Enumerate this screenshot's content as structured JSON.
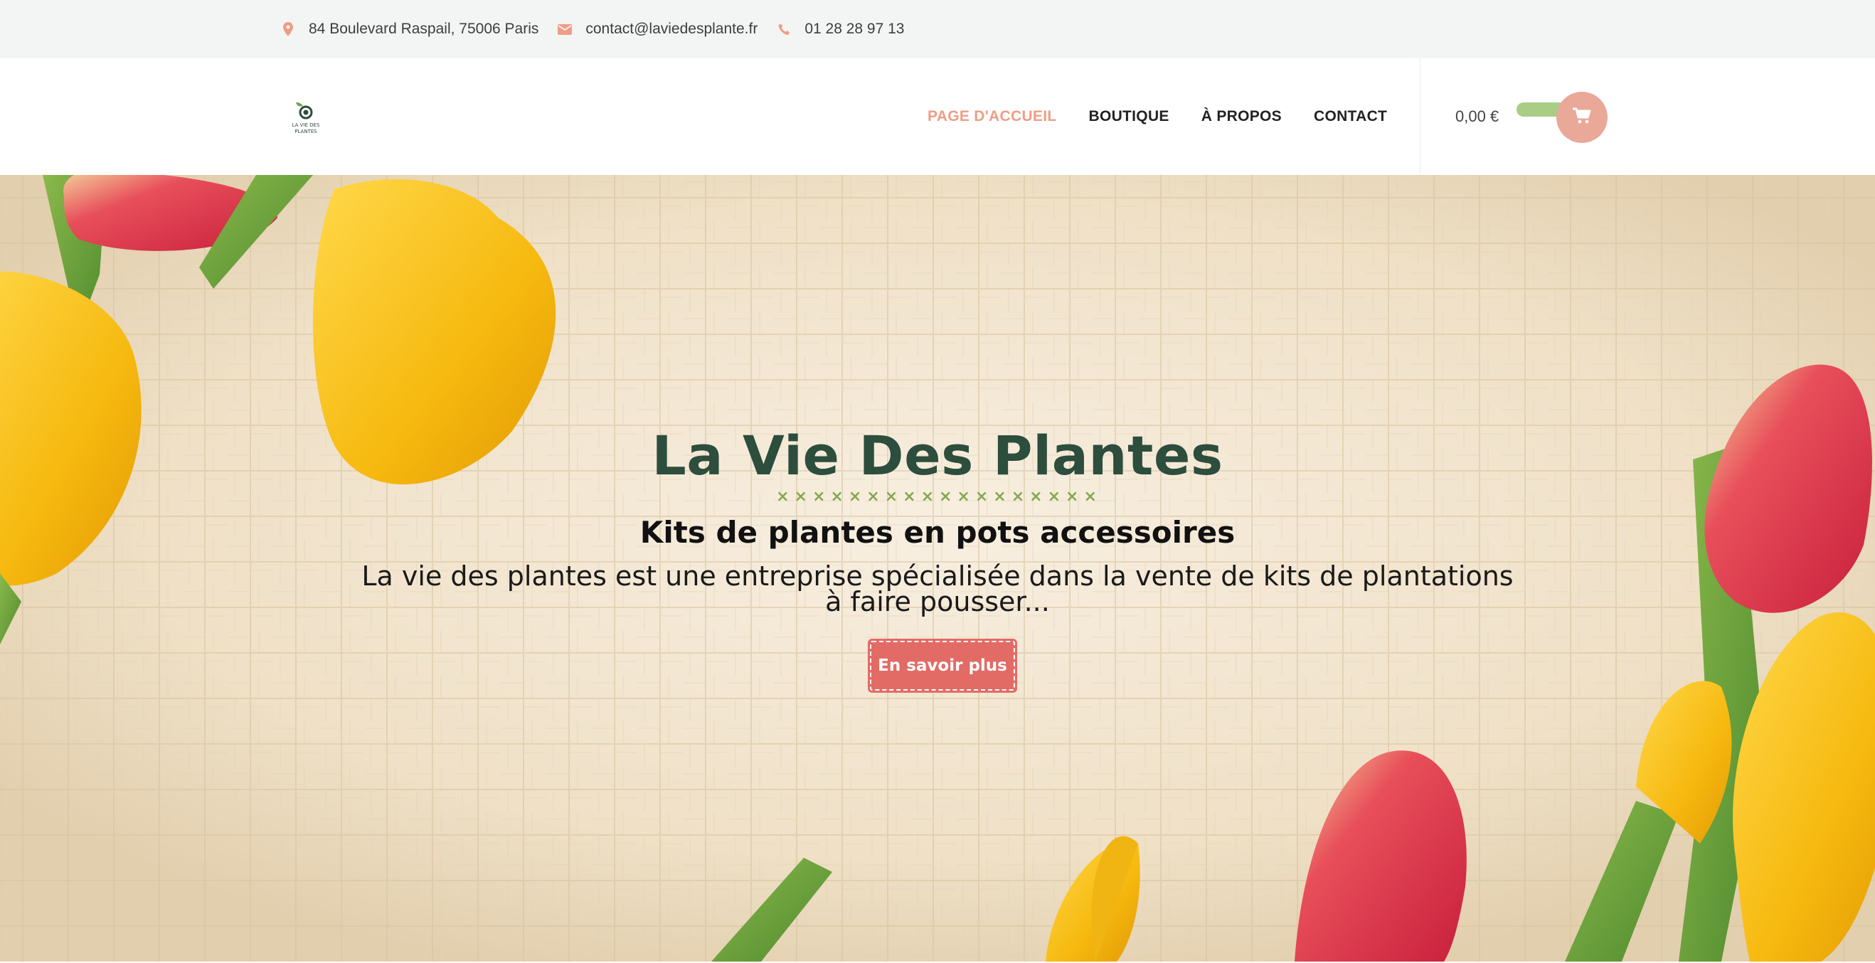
{
  "topbar": {
    "address": "84 Boulevard Raspail, 75006 Paris",
    "email": "contact@laviedesplante.fr",
    "phone": "01 28 28 97 13",
    "icons": {
      "address": "map-pin-icon",
      "email": "envelope-icon",
      "phone": "phone-icon"
    },
    "icon_color": "#ee9d86"
  },
  "header": {
    "logo_text": "LA VIE DES PLANTES",
    "nav": [
      {
        "label": "PAGE D'ACCUEIL",
        "active": true
      },
      {
        "label": "BOUTIQUE",
        "active": false
      },
      {
        "label": "À PROPOS",
        "active": false
      },
      {
        "label": "CONTACT",
        "active": false
      }
    ],
    "cart_total": "0,00 €",
    "cart_icon": "cart-icon",
    "active_color": "#ee9d86"
  },
  "hero": {
    "title": "La Vie Des Plantes",
    "divider": "××××××××××××××××××",
    "subtitle": "Kits de plantes en pots accessoires",
    "description": "La vie des plantes est une entreprise spécialisée dans la vente de kits de plantations à faire pousser...",
    "cta_label": "En savoir plus",
    "cta_color": "#e26b66",
    "title_color": "#2d4d3d"
  }
}
